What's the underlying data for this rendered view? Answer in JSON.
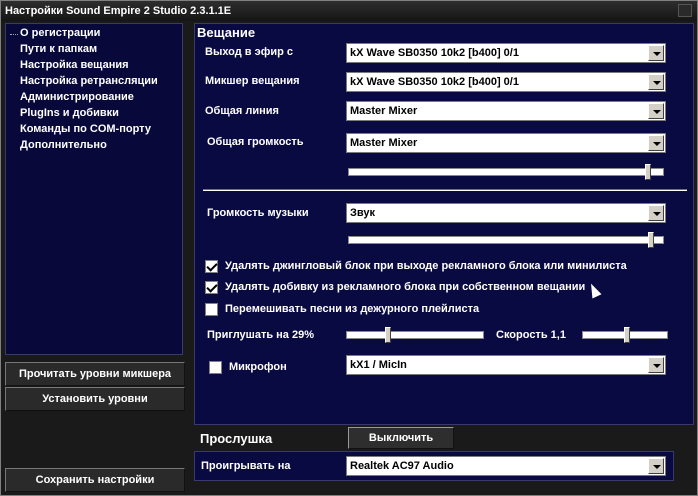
{
  "window": {
    "title": "Настройки Sound Empire 2 Studio 2.3.1.1E"
  },
  "nav": {
    "items": [
      "О регистрации",
      "Пути к папкам",
      "Настройка вещания",
      "Настройка ретрансляции",
      "Администрирование",
      "PlugIns и добивки",
      "Команды по COM-порту",
      "Дополнительно"
    ]
  },
  "side_buttons": {
    "read_levels": "Прочитать уровни микшера",
    "set_levels": "Установить уровни",
    "save": "Сохранить настройки"
  },
  "broadcast": {
    "title": "Вещание",
    "output_label": "Выход в эфир с",
    "output_value": "kX Wave SB0350 10k2 [b400] 0/1",
    "mixer_label": "Микшер вещания",
    "mixer_value": "kX Wave SB0350 10k2 [b400] 0/1",
    "line_label": "Общая линия",
    "line_value": "Master Mixer",
    "volume_label": "Общая громкость",
    "volume_value": "Master Mixer",
    "volume_level_percent": 96,
    "music_label": "Громкость музыки",
    "music_value": "Звук",
    "music_level_percent": 97,
    "chk1_label": "Удалять джингловый блок при выходе рекламного блока или минилиста",
    "chk1_checked": true,
    "chk2_label": "Удалять добивку из рекламного блока при собственном вещании",
    "chk2_checked": true,
    "chk3_label": "Перемешивать песни из дежурного плейлиста",
    "chk3_checked": false,
    "mute_label": "Приглушать на 29%",
    "mute_level_percent": 29,
    "speed_label": "Скорость 1,1",
    "speed_level_percent": 52,
    "mic_label": "Микрофон",
    "mic_checked": false,
    "mic_value": "kX1 / MicIn"
  },
  "monitor": {
    "title": "Прослушка",
    "off_button": "Выключить",
    "play_label": "Проигрывать на",
    "play_value": "Realtek AC97 Audio"
  },
  "colors": {
    "panel": "#0a0a42",
    "nav": "#08083a",
    "frame": "#1a1a1a"
  }
}
